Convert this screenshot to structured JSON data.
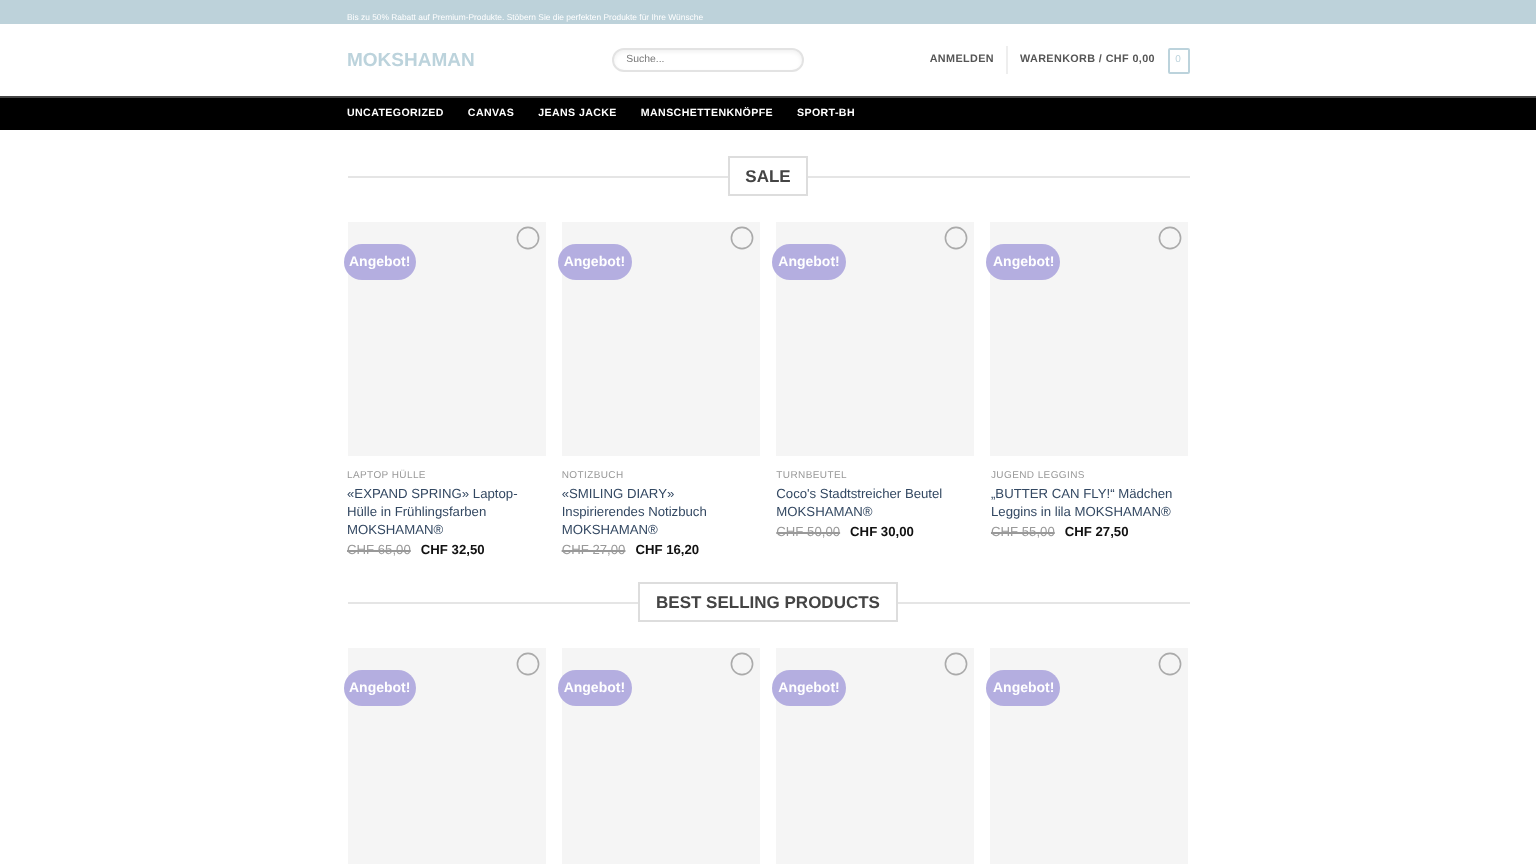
{
  "top_bar": {
    "text": "Bis zu 50% Rabatt auf Premium-Produkte. Stöbern Sie die perfekten Produkte für Ihre Wünsche"
  },
  "header": {
    "logo": "MOKSHAMAN",
    "search": {
      "placeholder": "Suche..."
    },
    "login": "ANMELDEN",
    "cart": "WARENKORB / CHF 0,00",
    "cart_count": "0"
  },
  "nav": [
    "UNCATEGORIZED",
    "CANVAS",
    "JEANS JACKE",
    "MANSCHETTENKNÖPFE",
    "SPORT-BH"
  ],
  "sections": [
    {
      "title": "SALE",
      "products": [
        {
          "badge": "Angebot!",
          "category": "LAPTOP HÜLLE",
          "title": "«EXPAND SPRING» Laptop-Hülle in Frühlingsfarben MOKSHAMAN®",
          "old_price": "CHF 65,00",
          "price": "CHF 32,50"
        },
        {
          "badge": "Angebot!",
          "category": "NOTIZBUCH",
          "title": "«SMILING DIARY» Inspirierendes Notizbuch MOKSHAMAN®",
          "old_price": "CHF 27,00",
          "price": "CHF 16,20"
        },
        {
          "badge": "Angebot!",
          "category": "TURNBEUTEL",
          "title": "Coco's Stadtstreicher Beutel MOKSHAMAN®",
          "old_price": "CHF 50,00",
          "price": "CHF 30,00"
        },
        {
          "badge": "Angebot!",
          "category": "JUGEND LEGGINS",
          "title": "„BUTTER CAN FLY!“ Mädchen Leggins in lila MOKSHAMAN®",
          "old_price": "CHF 55,00",
          "price": "CHF 27,50"
        }
      ]
    },
    {
      "title": "BEST SELLING PRODUCTS",
      "products": [
        {
          "badge": "Angebot!"
        },
        {
          "badge": "Angebot!"
        },
        {
          "badge": "Angebot!"
        },
        {
          "badge": "Angebot!"
        }
      ]
    }
  ]
}
